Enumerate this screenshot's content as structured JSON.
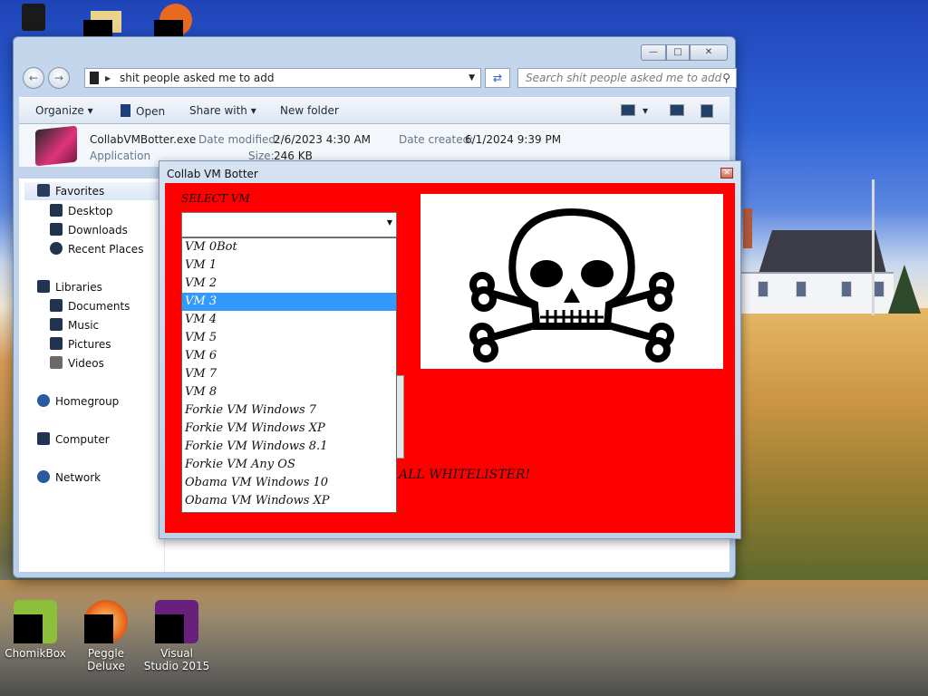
{
  "desktop": {
    "icons": [
      {
        "name": "chomikbox",
        "label": "ChomikBox",
        "color": "#8cbf3a"
      },
      {
        "name": "peggle-deluxe",
        "label": "Peggle Deluxe",
        "color": "#e86a1e"
      },
      {
        "name": "visual-studio-2015",
        "label": "Visual Studio 2015",
        "color": "#68217a"
      }
    ]
  },
  "explorer": {
    "address": "shit people asked me to add",
    "search_placeholder": "Search shit people asked me to add",
    "toolbar": {
      "organize": "Organize",
      "open": "Open",
      "share_with": "Share with",
      "new_folder": "New folder"
    },
    "details": {
      "file_name": "CollabVMBotter.exe",
      "file_type": "Application",
      "date_modified_label": "Date modified:",
      "date_modified": "2/6/2023 4:30 AM",
      "date_created_label": "Date created:",
      "date_created": "6/1/2024 9:39 PM",
      "size_label": "Size:",
      "size": "246 KB"
    },
    "nav": {
      "favorites": "Favorites",
      "desktop": "Desktop",
      "downloads": "Downloads",
      "recent_places": "Recent Places",
      "libraries": "Libraries",
      "documents": "Documents",
      "music": "Music",
      "pictures": "Pictures",
      "videos": "Videos",
      "homegroup": "Homegroup",
      "computer": "Computer",
      "network": "Network"
    }
  },
  "botter": {
    "title": "Collab VM Botter",
    "select_label": "SELECT VM",
    "selected_index": 3,
    "options": [
      "VM 0Bot",
      "VM 1",
      "VM 2",
      "VM 3",
      "VM 4",
      "VM 5",
      "VM 6",
      "VM 7",
      "VM 8",
      "Forkie VM Windows 7",
      "Forkie VM Windows XP",
      "Forkie VM Windows 8.1",
      "Forkie VM Any OS",
      "Obama VM Windows 10",
      "Obama VM Windows XP"
    ],
    "whitelist_text": "ALL WHITELISTER!",
    "client_color": "#ff0000"
  }
}
